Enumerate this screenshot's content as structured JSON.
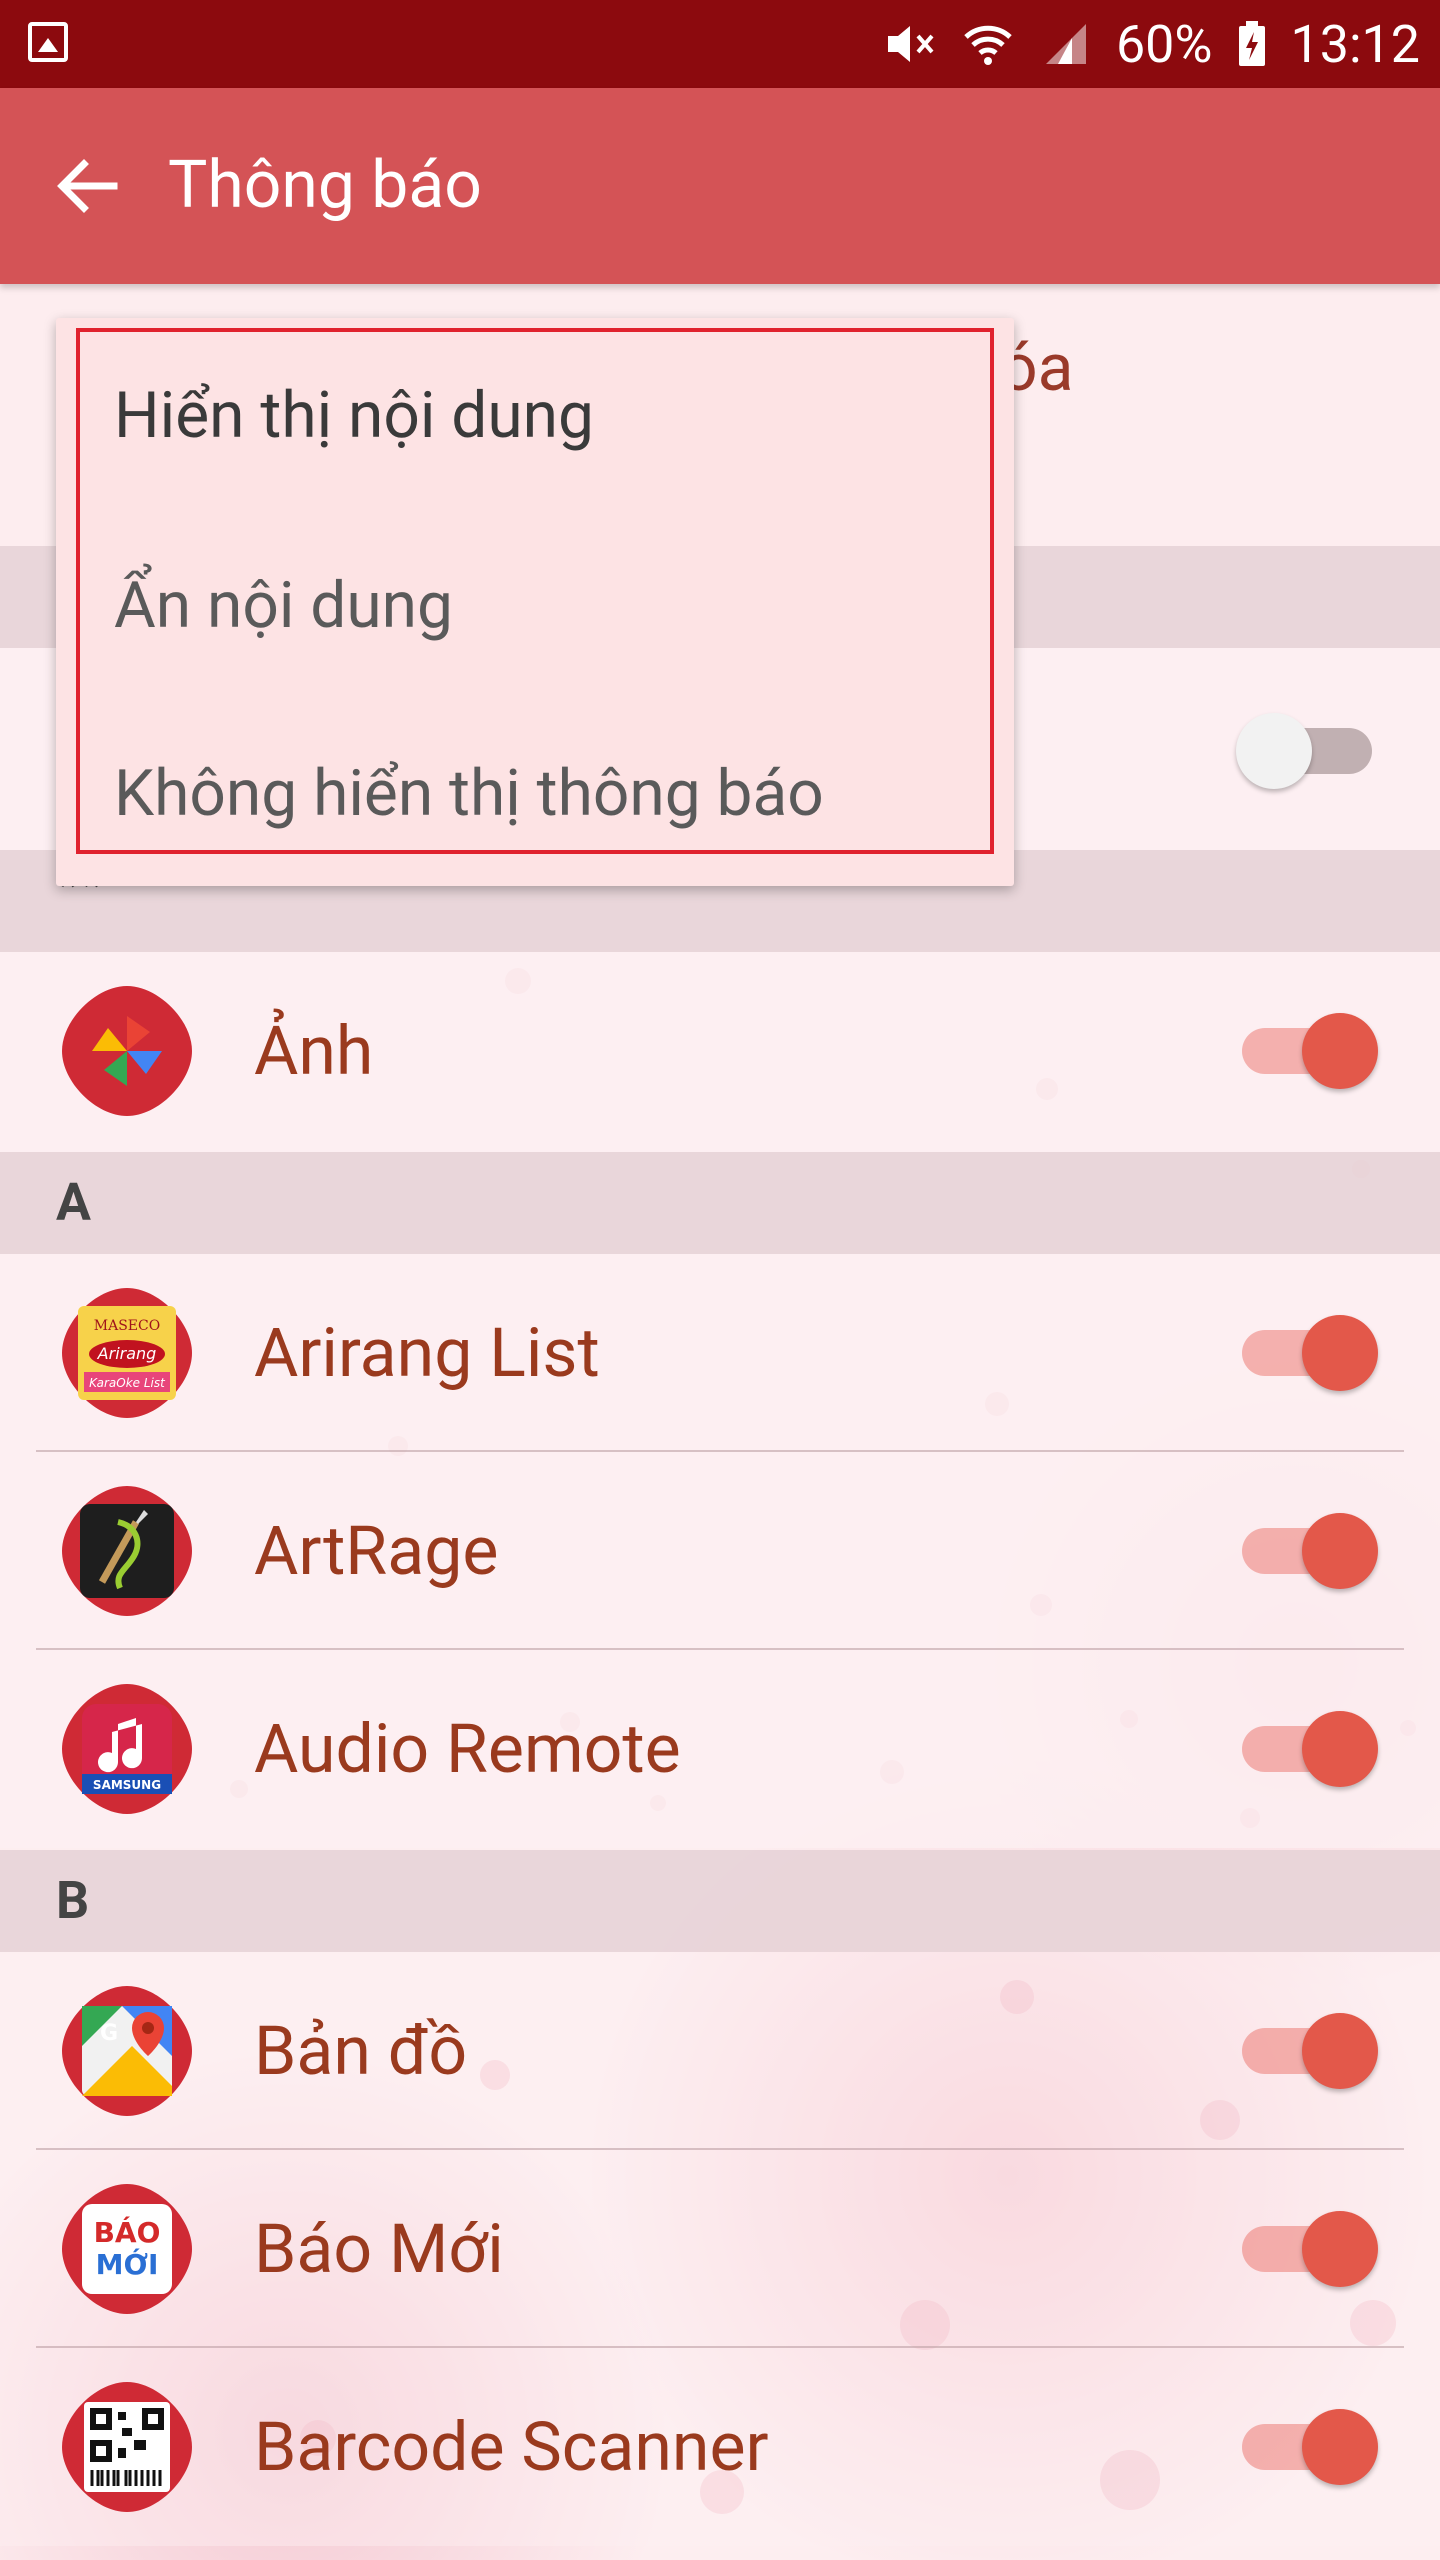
{
  "status_bar": {
    "battery": "60%",
    "time": "13:12",
    "icons": [
      "gallery-notification-icon",
      "mute-icon",
      "wifi-icon",
      "signal-icon",
      "battery-charging-icon"
    ]
  },
  "app_bar": {
    "title": "Thông báo",
    "back_icon": "arrow-left-icon",
    "color": "#d45356"
  },
  "top_row": {
    "partial_text": "óa"
  },
  "dropdown": {
    "options": [
      "Hiển thị nội dung",
      "Ẩn nội dung",
      "Không hiển thị thông báo"
    ]
  },
  "sections": [
    {
      "label": "**"
    },
    {
      "label": "A"
    },
    {
      "label": "B"
    }
  ],
  "apps": [
    {
      "label": "Ảnh",
      "icon": "photos-pinwheel-icon",
      "enabled": true
    },
    {
      "label": "Arirang List",
      "icon": "arirang-karaoke-icon",
      "enabled": true
    },
    {
      "label": "ArtRage",
      "icon": "artrage-brush-icon",
      "enabled": true
    },
    {
      "label": "Audio Remote",
      "icon": "samsung-music-icon",
      "enabled": true
    },
    {
      "label": "Bản đồ",
      "icon": "google-maps-icon",
      "enabled": true
    },
    {
      "label": "Báo Mới",
      "icon": "baomoi-icon",
      "enabled": true
    },
    {
      "label": "Barcode Scanner",
      "icon": "qr-barcode-icon",
      "enabled": true
    }
  ],
  "hidden_toggle": {
    "enabled": false
  },
  "colors": {
    "toggle_on": "#e3584a",
    "label": "#9a3a1e",
    "status_bar": "#8c0a0e"
  }
}
